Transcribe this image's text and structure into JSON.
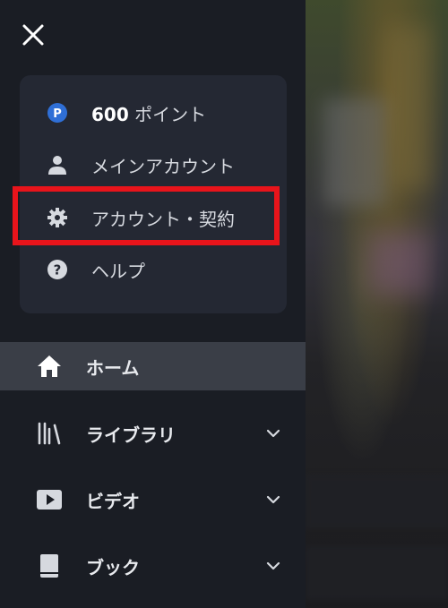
{
  "account": {
    "points_value": "600",
    "points_unit": " ポイント",
    "main_account": "メインアカウント",
    "account_contract": "アカウント・契約",
    "help": "ヘルプ"
  },
  "nav": {
    "home": "ホーム",
    "library": "ライブラリ",
    "video": "ビデオ",
    "book": "ブック"
  },
  "colors": {
    "drawer_bg": "#1a1d24",
    "card_bg": "#242833",
    "active_bg": "#3a3e47",
    "highlight": "#e8141b",
    "points_badge": "#2f6fd6"
  },
  "icons": [
    "close-icon",
    "points-icon",
    "person-icon",
    "gear-icon",
    "help-icon",
    "home-icon",
    "library-icon",
    "video-icon",
    "book-icon",
    "chevron-down-icon"
  ]
}
